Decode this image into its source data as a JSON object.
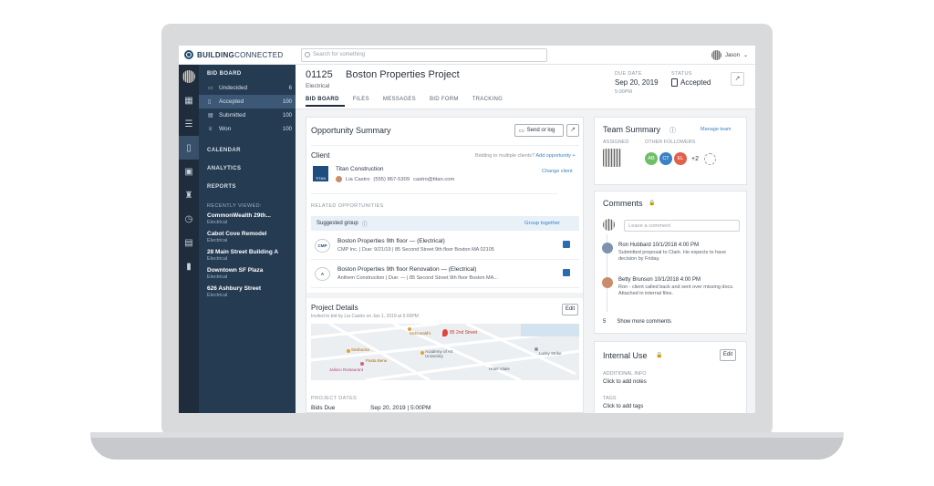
{
  "topbar": {
    "logo_bold": "BUILDING",
    "logo_light": "CONNECTED",
    "search_placeholder": "Search for something",
    "user_name": "Jason"
  },
  "sidebar": {
    "heading": "BID BOARD",
    "items": [
      {
        "label": "Undecided",
        "count": "6",
        "icon": "inbox-icon",
        "active": false
      },
      {
        "label": "Accepted",
        "count": "100",
        "icon": "clipboard-icon",
        "active": true
      },
      {
        "label": "Submitted",
        "count": "100",
        "icon": "document-icon",
        "active": false
      },
      {
        "label": "Won",
        "count": "100",
        "icon": "trophy-icon",
        "active": false
      }
    ],
    "links": [
      "CALENDAR",
      "ANALYTICS",
      "REPORTS"
    ],
    "recent_heading": "RECENTLY VIEWED:",
    "recent": [
      {
        "title": "CommonWealth 29th...",
        "trade": "Electrical"
      },
      {
        "title": "Cabot Cove Remodel",
        "trade": "Electrical"
      },
      {
        "title": "28 Main Street Building A",
        "trade": "Electrical"
      },
      {
        "title": "Downtown SF Plaza",
        "trade": "Electrical"
      },
      {
        "title": "626 Ashbury Street",
        "trade": "Electrical"
      }
    ]
  },
  "project": {
    "number": "01125",
    "title": "Boston Properties Project",
    "trade": "Electrical",
    "tabs": [
      "BID BOARD",
      "FILES",
      "MESSAGES",
      "BID FORM",
      "TRACKING"
    ],
    "due_label": "DUE DATE",
    "due_date": "Sep 20, 2019",
    "due_time": "5:00PM",
    "status_label": "STATUS",
    "status_value": "Accepted"
  },
  "opportunity": {
    "title": "Opportunity Summary",
    "send_label": "Send or log",
    "client_label": "Client",
    "bidding_text": "Bidding to multiple clients?",
    "add_opportunity": "Add opportunity +",
    "client_name": "Titan Construction",
    "contact_name": "Lia Castro",
    "contact_phone": "(555) 867-5309",
    "contact_email": "castro@titan.com",
    "change_client": "Change client",
    "logo_text": "TITAN",
    "related_heading": "RELATED OPPORTUNITIES",
    "suggested_label": "Suggested group",
    "group_together": "Group together",
    "related": [
      {
        "logo": "CMP",
        "title": "Boston Properties 9th floor  —  (Electrical)",
        "detail": "CMP Inc.  |  Due: 9/21/19  |  85 Second Street 9th floor Boston MA 02105"
      },
      {
        "logo": "A",
        "title": "Boston Properties 9th floor Renovation  —  (Electrical)",
        "detail": "Anthem Construction  |  Due: —  |  85 Second Street 9th floor Boston MA..."
      }
    ],
    "details_title": "Project Details",
    "invited_text": "Invited to bid by Lia Castro on Jan 1, 2019 at 5:00PM",
    "edit_label": "Edit",
    "map_pin_label": "85 2nd Street",
    "map_labels": [
      "McDonald's",
      "Starbucks",
      "Academy of Art University",
      "Jalisco Restaurant",
      "Pasta Bene",
      "Hotel Vitale",
      "Lucky Strike"
    ],
    "dates_heading": "PROJECT DATES",
    "bids_due_label": "Bids Due",
    "bids_due_value": "Sep 20, 2019  |  5:00PM"
  },
  "team": {
    "title": "Team Summary",
    "manage_team": "Manage team",
    "assigned_label": "ASSIGNED",
    "followers_label": "OTHER FOLLOWERS",
    "followers": [
      {
        "initials": "AB",
        "color": "#6fbf6a"
      },
      {
        "initials": "CT",
        "color": "#3a82c4"
      },
      {
        "initials": "EL",
        "color": "#e0604a"
      }
    ],
    "extra_count": "+2"
  },
  "comments": {
    "title": "Comments",
    "input_placeholder": "Leave a comment",
    "items": [
      {
        "name": "Ron Hubbard 10/1/2018 4:00 PM",
        "text": "Submitted proposal to Clark. He expects to have decision by Friday."
      },
      {
        "name": "Betty Brunson 10/1/2018 4:00 PM",
        "text": "Ron - client called back and sent over missing docs. Attached in internal files."
      }
    ],
    "more_count": "5",
    "more_label": "Show more comments"
  },
  "internal": {
    "title": "Internal Use",
    "edit_label": "Edit",
    "additional_heading": "ADDITIONAL INFO",
    "add_notes": "Click to add notes",
    "tags_heading": "TAGS",
    "add_tags": "Click to add tags"
  }
}
